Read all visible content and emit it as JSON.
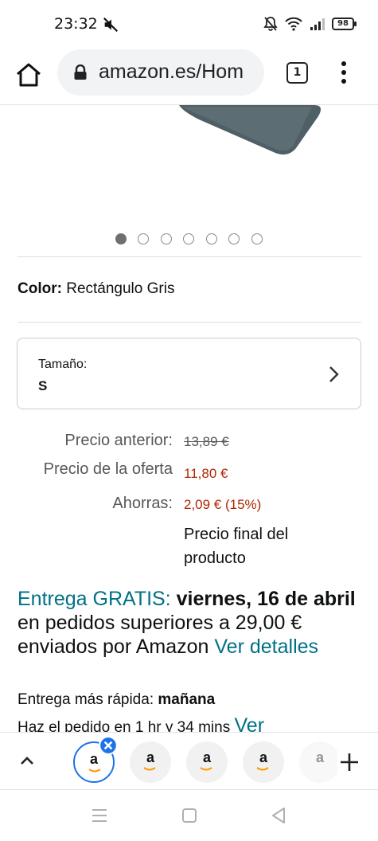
{
  "status_bar": {
    "time": "23:32",
    "battery": "98",
    "icons": [
      "mute-icon",
      "alarm-off-icon",
      "wifi-icon",
      "signal-icon",
      "battery-icon"
    ]
  },
  "browser": {
    "url": "amazon.es/Hom",
    "tab_count": "1",
    "icons": [
      "home-icon",
      "lock-icon",
      "tab-switcher-icon",
      "more-vert-icon"
    ]
  },
  "carousel": {
    "total_images": 7,
    "active_index": 0
  },
  "product": {
    "color_label": "Color:",
    "color_value": "Rectángulo Gris",
    "size_label": "Tamaño:",
    "size_value": "S"
  },
  "pricing": {
    "previous_label": "Precio anterior:",
    "previous_value": "13,89 €",
    "offer_label": "Precio de la oferta",
    "offer_value": "11,80 €",
    "savings_label": "Ahorras:",
    "savings_value": "2,09 € (15%)",
    "final_note": "Precio final del producto"
  },
  "delivery": {
    "free_label": "Entrega GRATIS:",
    "date": "viernes, 16 de abril",
    "condition": "en pedidos superiores a 29,00 € enviados por Amazon",
    "details_link": "Ver detalles",
    "fast_label": "Entrega más rápida:",
    "fast_value": "mañana",
    "order_text": "Haz el pedido en 1 hr y 34 mins",
    "order_link": "Ver"
  },
  "tab_group": {
    "tabs": [
      {
        "label": "a",
        "active": true
      },
      {
        "label": "a",
        "active": false
      },
      {
        "label": "a",
        "active": false
      },
      {
        "label": "a",
        "active": false
      },
      {
        "label": "a",
        "active": false
      }
    ]
  },
  "colors": {
    "link": "#007185",
    "price_red": "#b12704",
    "tab_active": "#1a73e8"
  }
}
